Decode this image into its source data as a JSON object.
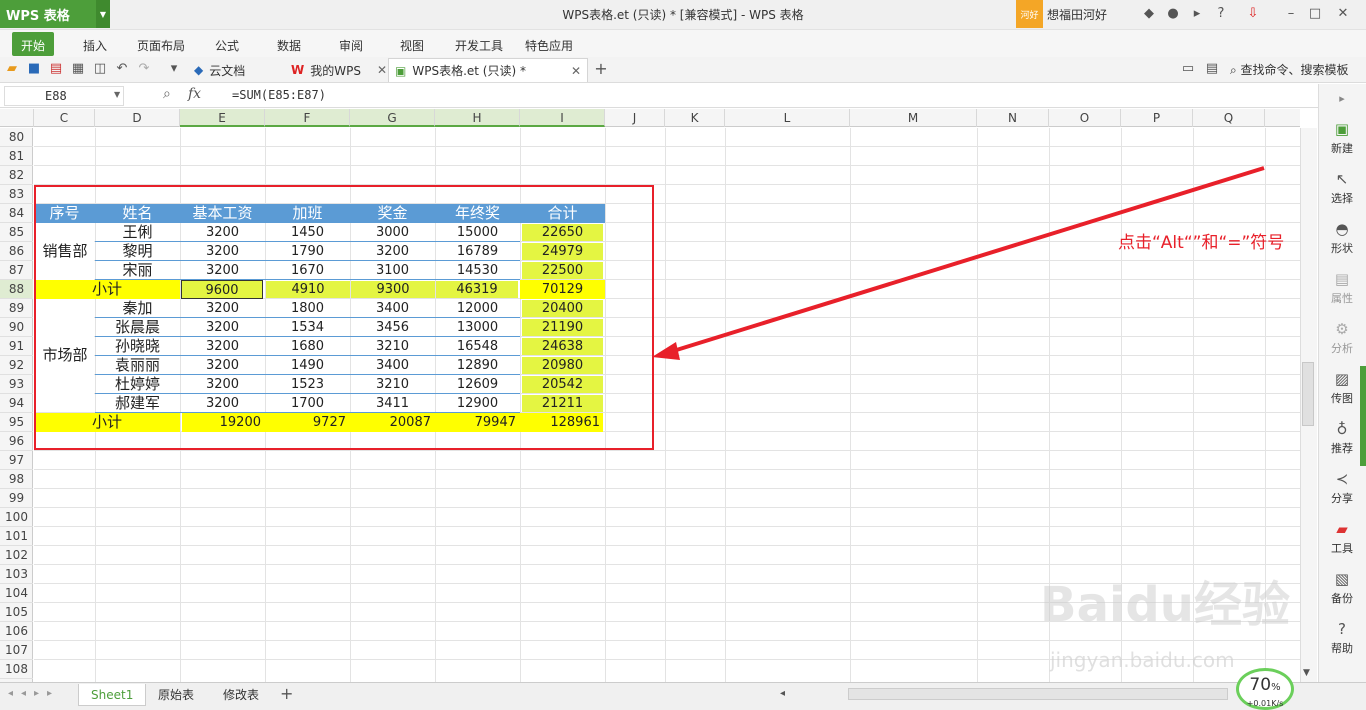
{
  "titlebar": {
    "app": "WPS 表格",
    "title": "WPS表格.et (只读) * [兼容模式] - WPS 表格",
    "greeting_badge": "河好",
    "user": "想福田河好"
  },
  "menu": [
    "开始",
    "插入",
    "页面布局",
    "公式",
    "数据",
    "审阅",
    "视图",
    "开发工具",
    "特色应用"
  ],
  "doc_tabs": {
    "cloud": "云文档",
    "mywps": "我的WPS",
    "file": "WPS表格.et (只读) *"
  },
  "toolbar_right": {
    "search": "查找命令、搜索模板"
  },
  "formula_bar": {
    "cell": "E88",
    "fx": "fx",
    "formula": "=SUM(E85:E87)"
  },
  "columns": [
    "C",
    "D",
    "E",
    "F",
    "G",
    "H",
    "I",
    "J",
    "K",
    "L",
    "M",
    "N",
    "O",
    "P",
    "Q"
  ],
  "rows": [
    "80",
    "81",
    "82",
    "83",
    "84",
    "85",
    "86",
    "87",
    "88",
    "89",
    "90",
    "91",
    "92",
    "93",
    "94",
    "95",
    "96",
    "97",
    "98",
    "99",
    "100",
    "101",
    "102",
    "103",
    "104",
    "105",
    "106",
    "107",
    "108"
  ],
  "table": {
    "headers": [
      "序号",
      "姓名",
      "基本工资",
      "加班",
      "奖金",
      "年终奖",
      "合计"
    ],
    "dept1": "销售部",
    "dept2": "市场部",
    "subtotal_label": "小计",
    "group1": [
      [
        "王俐",
        "3200",
        "1450",
        "3000",
        "15000",
        "22650"
      ],
      [
        "黎明",
        "3200",
        "1790",
        "3200",
        "16789",
        "24979"
      ],
      [
        "宋丽",
        "3200",
        "1670",
        "3100",
        "14530",
        "22500"
      ]
    ],
    "sub1": [
      "9600",
      "4910",
      "9300",
      "46319",
      "70129"
    ],
    "group2": [
      [
        "秦加",
        "3200",
        "1800",
        "3400",
        "12000",
        "20400"
      ],
      [
        "张晨晨",
        "3200",
        "1534",
        "3456",
        "13000",
        "21190"
      ],
      [
        "孙晓晓",
        "3200",
        "1680",
        "3210",
        "16548",
        "24638"
      ],
      [
        "袁丽丽",
        "3200",
        "1490",
        "3400",
        "12890",
        "20980"
      ],
      [
        "杜婷婷",
        "3200",
        "1523",
        "3210",
        "12609",
        "20542"
      ],
      [
        "郝建军",
        "3200",
        "1700",
        "3411",
        "12900",
        "21211"
      ]
    ],
    "sub2": [
      "19200",
      "9727",
      "20087",
      "79947",
      "128961"
    ]
  },
  "sidebar": [
    "新建",
    "选择",
    "形状",
    "属性",
    "分析",
    "传图",
    "推荐",
    "分享",
    "工具",
    "备份",
    "帮助"
  ],
  "sheets": [
    "Sheet1",
    "原始表",
    "修改表"
  ],
  "zoom": {
    "percent": "70",
    "unit": "%",
    "net": "+0.01K/s"
  },
  "annotation": "点击“Alt“”和“=”符号",
  "watermark": "Baidu经验",
  "watermark_url": "jingyan.baidu.com"
}
